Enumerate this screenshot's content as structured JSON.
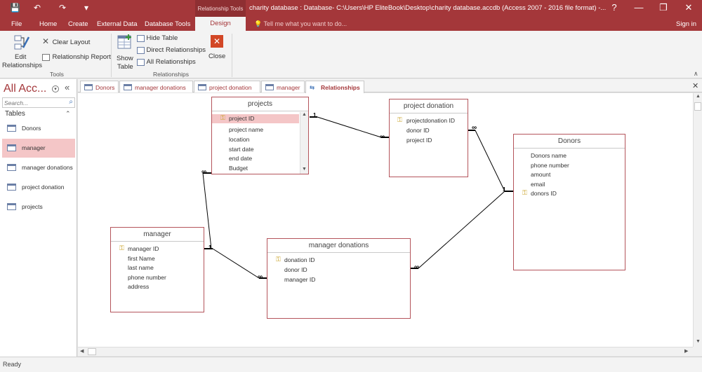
{
  "window": {
    "context_tab": "Relationship Tools",
    "title": "charity database : Database- C:\\Users\\HP EliteBook\\Desktop\\charity database.accdb (Access 2007 - 2016 file format) -...",
    "help": "?",
    "minimize": "—",
    "restore": "❐",
    "close": "✕",
    "qa_save": "💾",
    "qa_undo": "↶",
    "qa_redo": "↷",
    "qa_custom": "▾"
  },
  "ribbon_tabs": [
    "File",
    "Home",
    "Create",
    "External Data",
    "Database Tools",
    "Design"
  ],
  "tell_me": "Tell me what you want to do...",
  "sign_in": "Sign in",
  "ribbon": {
    "edit_relationships": "Edit Relationships",
    "edit_line1": "Edit",
    "edit_line2": "Relationships",
    "clear_layout": "Clear Layout",
    "relationship_report": "Relationship Report",
    "group_tools": "Tools",
    "show_table_line1": "Show",
    "show_table_line2": "Table",
    "hide_table": "Hide Table",
    "direct_relationships": "Direct Relationships",
    "all_relationships": "All Relationships",
    "close": "Close",
    "group_relationships": "Relationships"
  },
  "nav": {
    "title": "All Acc...",
    "search_placeholder": "Search...",
    "section": "Tables",
    "items": [
      "Donors",
      "manager",
      "manager donations",
      "project donation",
      "projects"
    ],
    "selected": "manager"
  },
  "doc_tabs": [
    "Donors",
    "manager donations",
    "project donation",
    "manager",
    "Relationships"
  ],
  "active_doc_tab": "Relationships",
  "tables": {
    "projects": {
      "title": "projects",
      "fields": [
        "project ID",
        "project name",
        "location",
        "start date",
        "end date",
        "Budget"
      ]
    },
    "project_donation": {
      "title": "project donation",
      "fields": [
        "projectdonation ID",
        "donor ID",
        "project ID"
      ]
    },
    "donors": {
      "title": "Donors",
      "fields": [
        "Donors name",
        "phone number",
        "amount",
        "email",
        "donors ID"
      ]
    },
    "manager": {
      "title": "manager",
      "fields": [
        "manager ID",
        "first Name",
        "last name",
        "phone number",
        "address"
      ]
    },
    "manager_donations": {
      "title": "manager donations",
      "fields": [
        "donation ID",
        "donor ID",
        "manager ID"
      ]
    }
  },
  "relationship_markers": {
    "one": "1",
    "many": "∞"
  },
  "status": "Ready"
}
